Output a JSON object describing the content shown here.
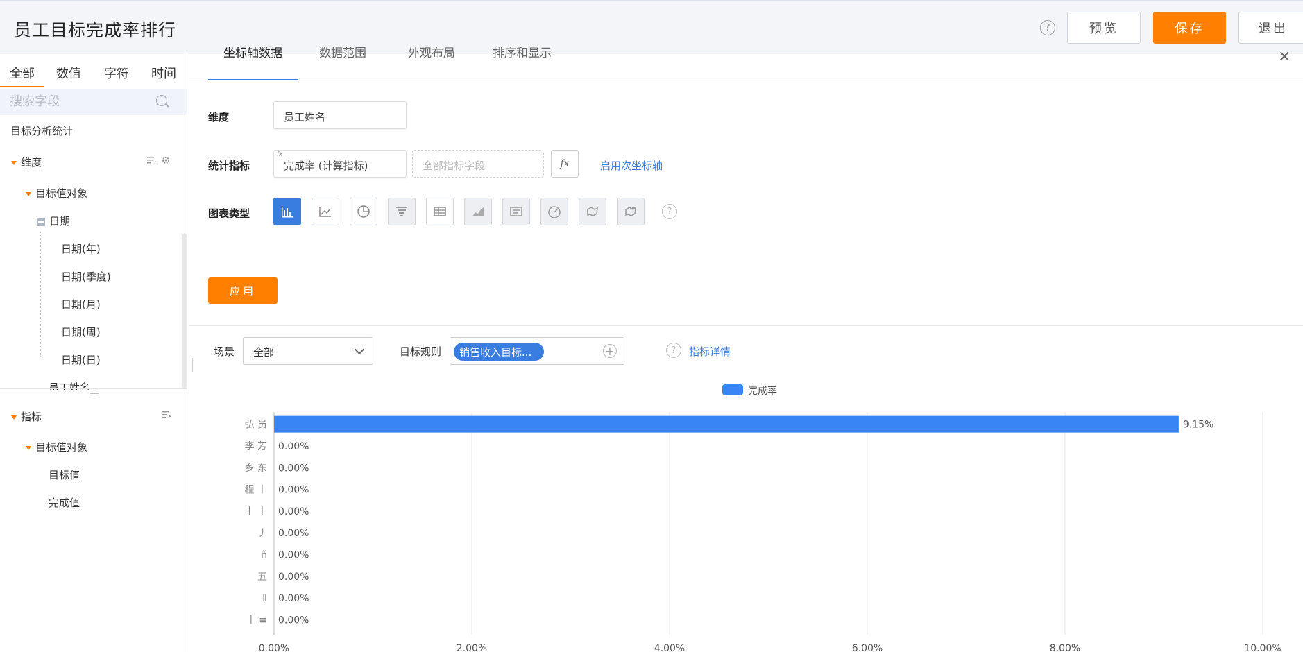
{
  "header": {
    "title": "员工目标完成率排行",
    "help": "?",
    "preview_label": "预览",
    "save_label": "保存",
    "exit_label": "退出"
  },
  "left_panel": {
    "tabs": [
      "全部",
      "数值",
      "字符",
      "时间"
    ],
    "search_placeholder": "搜索字段",
    "section_title": "目标分析统计",
    "dimension_label": "维度",
    "dimension_group": "目标值对象",
    "date_node": "日期",
    "date_children": [
      "日期(年)",
      "日期(季度)",
      "日期(月)",
      "日期(周)",
      "日期(日)"
    ],
    "employee_field": "员工姓名",
    "metric_label": "指标",
    "metric_group": "目标值对象",
    "metric_children": [
      "目标值",
      "完成值"
    ]
  },
  "config": {
    "tabs": [
      "坐标轴数据",
      "数据范围",
      "外观布局",
      "排序和显示"
    ],
    "dimension_label": "维度",
    "dimension_value": "员工姓名",
    "metric_label": "统计指标",
    "metric_value": "完成率 (计算指标)",
    "metric_fx_tag": "fx",
    "metric_placeholder": "全部指标字段",
    "fx_button": "fx",
    "secondary_axis_link": "启用次坐标轴",
    "chart_type_label": "图表类型",
    "chart_types": [
      "bar-chart-icon",
      "line-chart-icon",
      "pie-chart-icon",
      "funnel-chart-icon",
      "table-icon",
      "area-chart-icon",
      "text-card-icon",
      "gauge-icon",
      "map-icon",
      "map-pin-icon"
    ],
    "help": "?",
    "apply_label": "应用"
  },
  "filters": {
    "scene_label": "场景",
    "scene_value": "全部",
    "rule_label": "目标规则",
    "rule_chip": "销售收入目标...",
    "help": "?",
    "detail_link": "指标详情"
  },
  "chart_data": {
    "type": "bar",
    "orientation": "horizontal",
    "legend": [
      "完成率"
    ],
    "series_color": "#3a85f5",
    "categories": [
      "弘  员",
      "李 芳",
      "乡 东",
      "程 丨",
      "丨 丨",
      "丿",
      "ñ",
      "五",
      "Ⅱ",
      "丨 ≡"
    ],
    "values": [
      9.15,
      0,
      0,
      0,
      0,
      0,
      0,
      0,
      0,
      0
    ],
    "value_labels": [
      "9.15%",
      "0.00%",
      "0.00%",
      "0.00%",
      "0.00%",
      "0.00%",
      "0.00%",
      "0.00%",
      "0.00%",
      "0.00%"
    ],
    "x_ticks": [
      "0.00%",
      "2.00%",
      "4.00%",
      "6.00%",
      "8.00%",
      "10.00%"
    ],
    "xlim": [
      0,
      10
    ],
    "grid": true
  }
}
